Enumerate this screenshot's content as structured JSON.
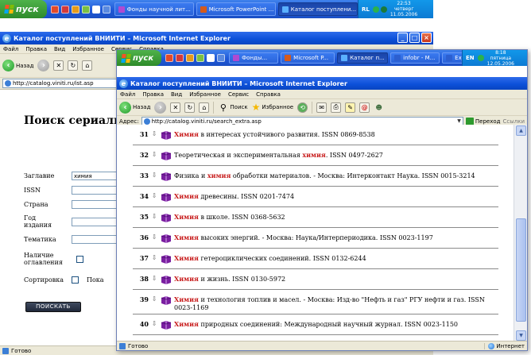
{
  "colors": {
    "xp_blue": "#1f58d8",
    "keyword_red": "#c81e1e",
    "book_purple": "#7a1fa0"
  },
  "back": {
    "taskbar": {
      "start_label": "пуск",
      "tasks": [
        {
          "label": "Фонды научной лит..."
        },
        {
          "label": "Microsoft PowerPoint ..."
        },
        {
          "label": "Каталог поступлени..."
        }
      ],
      "lang": "RL",
      "clock": {
        "time": "22:53",
        "day": "четверг",
        "date": "11.05.2006"
      }
    },
    "title": "Каталог поступлений ВНИИТИ – Microsoft Internet Explorer",
    "menu": [
      "Файл",
      "Правка",
      "Вид",
      "Избранное",
      "Сервис",
      "Справка"
    ],
    "back_label": "Назад",
    "address": "http://catalog.viniti.ru/ist.asp",
    "heading": "Поиск сериальн",
    "form": {
      "title_label": "Заглавие",
      "title_value": "химия",
      "issn_label": "ISSN",
      "country_label": "Страна",
      "year_label": "Год издания",
      "subject_label": "Тематика",
      "toc_label": "Наличие оглавления",
      "sort_label": "Сортировка",
      "show_label": "Пока",
      "search_button": "ПОИСКАТЬ"
    },
    "status": "Готово"
  },
  "front": {
    "taskbar": {
      "start_label": "пуск",
      "tasks": [
        {
          "label": "Фонды..."
        },
        {
          "label": "Microsoft P..."
        },
        {
          "label": "Каталог п..."
        },
        {
          "label": "infobr - M..."
        },
        {
          "label": "Ex_ogl - M..."
        }
      ],
      "lang": "EN",
      "clock": {
        "time": "8:18",
        "day": "пятница",
        "date": "12.05.2006"
      }
    },
    "title": "Каталог поступлений ВНИИТИ – Microsoft Internet Explorer",
    "menu": [
      "Файл",
      "Правка",
      "Вид",
      "Избранное",
      "Сервис",
      "Справка"
    ],
    "toolbar": {
      "back": "Назад",
      "search": "Поиск",
      "favorites": "Избранное"
    },
    "address_label": "Адрес:",
    "address": "http://catalog.viniti.ru/search_extra.asp",
    "go_label": "Переход",
    "links_label": "Ссылки",
    "results": [
      {
        "num": "31",
        "keyword": "Химия",
        "rest": " в интересах устойчивого развития. ISSN 0869-8538"
      },
      {
        "num": "32",
        "keyword": "",
        "before": "Теоретическая и экспериментальная ",
        "kw2": "химия",
        "rest": ". ISSN 0497-2627"
      },
      {
        "num": "33",
        "keyword": "",
        "before": "Физика и ",
        "kw2": "химия",
        "rest": " обработки материалов. - Москва: Интерконтакт Наука. ISSN 0015-3214"
      },
      {
        "num": "34",
        "keyword": "Химия",
        "rest": " древесины. ISSN 0201-7474"
      },
      {
        "num": "35",
        "keyword": "Химия",
        "rest": " в школе. ISSN 0368-5632"
      },
      {
        "num": "36",
        "keyword": "Химия",
        "rest": " высоких энергий. - Москва: Наука/Интерпериодика. ISSN 0023-1197"
      },
      {
        "num": "37",
        "keyword": "Химия",
        "rest": " гетероциклических соединений. ISSN 0132-6244"
      },
      {
        "num": "38",
        "keyword": "Химия",
        "rest": " и жизнь. ISSN 0130-5972"
      },
      {
        "num": "39",
        "keyword": "Химия",
        "rest": " и технология топлив и масел. - Москва: Изд-во \"Нефть и газ\" РГУ нефти и газ. ISSN 0023-1169"
      },
      {
        "num": "40",
        "keyword": "Химия",
        "rest": " природных соединений: Международный научный журнал. ISSN 0023-1150"
      }
    ],
    "status": "Готово",
    "zone": "Интернет"
  }
}
